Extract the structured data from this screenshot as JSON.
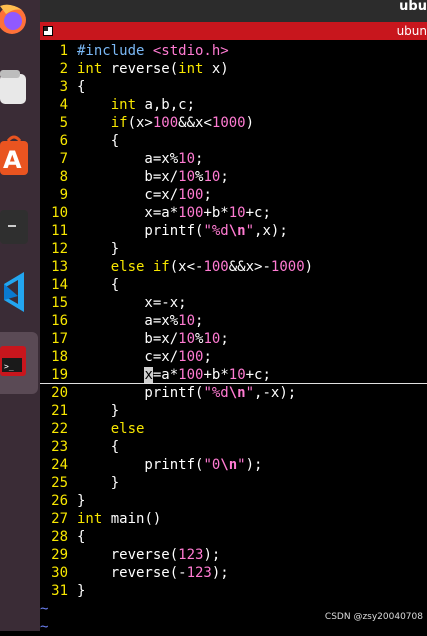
{
  "window": {
    "topbar_title": "ubu",
    "tab_label": "ubun"
  },
  "dock": {
    "items": [
      {
        "name": "firefox-icon"
      },
      {
        "name": "files-icon"
      },
      {
        "name": "app-store-icon"
      },
      {
        "name": "terminal-icon"
      },
      {
        "name": "vscode-icon"
      },
      {
        "name": "terminal-active-icon"
      }
    ]
  },
  "editor": {
    "cursor_line": 19,
    "lines": [
      {
        "n": "1",
        "tokens": [
          {
            "t": "#include ",
            "c": "pp"
          },
          {
            "t": "<stdio.h>",
            "c": "str"
          }
        ]
      },
      {
        "n": "2",
        "tokens": [
          {
            "t": "int",
            "c": "kw"
          },
          {
            "t": " reverse(",
            "c": ""
          },
          {
            "t": "int",
            "c": "kw"
          },
          {
            "t": " x)",
            "c": ""
          }
        ]
      },
      {
        "n": "3",
        "tokens": [
          {
            "t": "{",
            "c": ""
          }
        ]
      },
      {
        "n": "4",
        "tokens": [
          {
            "t": "    ",
            "c": ""
          },
          {
            "t": "int",
            "c": "kw"
          },
          {
            "t": " a,b,c;",
            "c": ""
          }
        ]
      },
      {
        "n": "5",
        "tokens": [
          {
            "t": "    ",
            "c": ""
          },
          {
            "t": "if",
            "c": "kw"
          },
          {
            "t": "(x>",
            "c": ""
          },
          {
            "t": "100",
            "c": "num"
          },
          {
            "t": "&&x<",
            "c": ""
          },
          {
            "t": "1000",
            "c": "num"
          },
          {
            "t": ")",
            "c": ""
          }
        ]
      },
      {
        "n": "6",
        "tokens": [
          {
            "t": "    {",
            "c": ""
          }
        ]
      },
      {
        "n": "7",
        "tokens": [
          {
            "t": "        a=x%",
            "c": ""
          },
          {
            "t": "10",
            "c": "num"
          },
          {
            "t": ";",
            "c": ""
          }
        ]
      },
      {
        "n": "8",
        "tokens": [
          {
            "t": "        b=x/",
            "c": ""
          },
          {
            "t": "10",
            "c": "num"
          },
          {
            "t": "%",
            "c": ""
          },
          {
            "t": "10",
            "c": "num"
          },
          {
            "t": ";",
            "c": ""
          }
        ]
      },
      {
        "n": "9",
        "tokens": [
          {
            "t": "        c=x/",
            "c": ""
          },
          {
            "t": "100",
            "c": "num"
          },
          {
            "t": ";",
            "c": ""
          }
        ]
      },
      {
        "n": "10",
        "tokens": [
          {
            "t": "        x=a*",
            "c": ""
          },
          {
            "t": "100",
            "c": "num"
          },
          {
            "t": "+b*",
            "c": ""
          },
          {
            "t": "10",
            "c": "num"
          },
          {
            "t": "+c;",
            "c": ""
          }
        ]
      },
      {
        "n": "11",
        "tokens": [
          {
            "t": "        printf(",
            "c": ""
          },
          {
            "t": "\"%d",
            "c": "str"
          },
          {
            "t": "\\n",
            "c": "esc"
          },
          {
            "t": "\"",
            "c": "str"
          },
          {
            "t": ",x);",
            "c": ""
          }
        ]
      },
      {
        "n": "12",
        "tokens": [
          {
            "t": "    }",
            "c": ""
          }
        ]
      },
      {
        "n": "13",
        "tokens": [
          {
            "t": "    ",
            "c": ""
          },
          {
            "t": "else if",
            "c": "kw"
          },
          {
            "t": "(x<-",
            "c": ""
          },
          {
            "t": "100",
            "c": "num"
          },
          {
            "t": "&&x>-",
            "c": ""
          },
          {
            "t": "1000",
            "c": "num"
          },
          {
            "t": ")",
            "c": ""
          }
        ]
      },
      {
        "n": "14",
        "tokens": [
          {
            "t": "    {",
            "c": ""
          }
        ]
      },
      {
        "n": "15",
        "tokens": [
          {
            "t": "        x=-x;",
            "c": ""
          }
        ]
      },
      {
        "n": "16",
        "tokens": [
          {
            "t": "        a=x%",
            "c": ""
          },
          {
            "t": "10",
            "c": "num"
          },
          {
            "t": ";",
            "c": ""
          }
        ]
      },
      {
        "n": "17",
        "tokens": [
          {
            "t": "        b=x/",
            "c": ""
          },
          {
            "t": "10",
            "c": "num"
          },
          {
            "t": "%",
            "c": ""
          },
          {
            "t": "10",
            "c": "num"
          },
          {
            "t": ";",
            "c": ""
          }
        ]
      },
      {
        "n": "18",
        "tokens": [
          {
            "t": "        c=x/",
            "c": ""
          },
          {
            "t": "100",
            "c": "num"
          },
          {
            "t": ";",
            "c": ""
          }
        ]
      },
      {
        "n": "19",
        "tokens": [
          {
            "t": "        ",
            "c": ""
          },
          {
            "t": "x",
            "c": "cursor"
          },
          {
            "t": "=a*",
            "c": ""
          },
          {
            "t": "100",
            "c": "num"
          },
          {
            "t": "+b*",
            "c": ""
          },
          {
            "t": "10",
            "c": "num"
          },
          {
            "t": "+c;",
            "c": ""
          }
        ]
      },
      {
        "n": "20",
        "tokens": [
          {
            "t": "        printf(",
            "c": ""
          },
          {
            "t": "\"%d",
            "c": "str"
          },
          {
            "t": "\\n",
            "c": "esc"
          },
          {
            "t": "\"",
            "c": "str"
          },
          {
            "t": ",-x);",
            "c": ""
          }
        ]
      },
      {
        "n": "21",
        "tokens": [
          {
            "t": "    }",
            "c": ""
          }
        ]
      },
      {
        "n": "22",
        "tokens": [
          {
            "t": "    ",
            "c": ""
          },
          {
            "t": "else",
            "c": "kw"
          }
        ]
      },
      {
        "n": "23",
        "tokens": [
          {
            "t": "    {",
            "c": ""
          }
        ]
      },
      {
        "n": "24",
        "tokens": [
          {
            "t": "        printf(",
            "c": ""
          },
          {
            "t": "\"0",
            "c": "str"
          },
          {
            "t": "\\n",
            "c": "esc"
          },
          {
            "t": "\"",
            "c": "str"
          },
          {
            "t": ");",
            "c": ""
          }
        ]
      },
      {
        "n": "25",
        "tokens": [
          {
            "t": "    }",
            "c": ""
          }
        ]
      },
      {
        "n": "26",
        "tokens": [
          {
            "t": "}",
            "c": ""
          }
        ]
      },
      {
        "n": "27",
        "tokens": [
          {
            "t": "int",
            "c": "kw"
          },
          {
            "t": " main()",
            "c": ""
          }
        ]
      },
      {
        "n": "28",
        "tokens": [
          {
            "t": "{",
            "c": ""
          }
        ]
      },
      {
        "n": "29",
        "tokens": [
          {
            "t": "    reverse(",
            "c": ""
          },
          {
            "t": "123",
            "c": "num"
          },
          {
            "t": ");",
            "c": ""
          }
        ]
      },
      {
        "n": "30",
        "tokens": [
          {
            "t": "    reverse(-",
            "c": ""
          },
          {
            "t": "123",
            "c": "num"
          },
          {
            "t": ");",
            "c": ""
          }
        ]
      },
      {
        "n": "31",
        "tokens": [
          {
            "t": "}",
            "c": ""
          }
        ]
      }
    ],
    "tildes": [
      "~",
      "~"
    ]
  },
  "watermark": "CSDN @zsy20040708",
  "colors": {
    "tab_red": "#c8161d",
    "keyword": "#f8e700",
    "line_number": "#f8e700",
    "string": "#ff7bd2",
    "preprocessor": "#7ab8f5",
    "tilde": "#6a7ff0"
  }
}
